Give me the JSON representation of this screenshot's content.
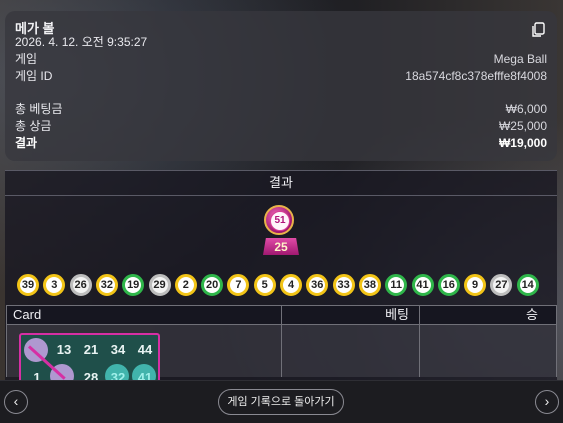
{
  "summary": {
    "title": "메가 볼",
    "datetime": "2026. 4. 12. 오전 9:35:27",
    "rows": [
      {
        "label": "게임",
        "value": "Mega Ball"
      },
      {
        "label": "게임 ID",
        "value": "18a574cf8c378efffe8f4008"
      }
    ],
    "totals": [
      {
        "label": "총 베팅금",
        "value": "₩6,000"
      },
      {
        "label": "총 상금",
        "value": "₩25,000"
      },
      {
        "label": "결과",
        "value": "₩19,000"
      }
    ]
  },
  "results": {
    "heading": "결과",
    "megaball": "51",
    "multiplier": "25",
    "balls": [
      {
        "n": "39",
        "c": "y"
      },
      {
        "n": "3",
        "c": "y"
      },
      {
        "n": "26",
        "c": "w"
      },
      {
        "n": "32",
        "c": "y"
      },
      {
        "n": "19",
        "c": "g"
      },
      {
        "n": "29",
        "c": "w"
      },
      {
        "n": "2",
        "c": "y"
      },
      {
        "n": "20",
        "c": "g"
      },
      {
        "n": "7",
        "c": "y"
      },
      {
        "n": "5",
        "c": "y"
      },
      {
        "n": "4",
        "c": "y"
      },
      {
        "n": "36",
        "c": "y"
      },
      {
        "n": "33",
        "c": "y"
      },
      {
        "n": "38",
        "c": "y"
      },
      {
        "n": "11",
        "c": "g"
      },
      {
        "n": "41",
        "c": "g"
      },
      {
        "n": "16",
        "c": "g"
      },
      {
        "n": "9",
        "c": "y"
      },
      {
        "n": "27",
        "c": "w"
      },
      {
        "n": "14",
        "c": "g"
      }
    ]
  },
  "table": {
    "headers": [
      "Card",
      "베팅",
      "승"
    ],
    "card_numbers": [
      "13",
      "21",
      "34",
      "44",
      "1",
      "28",
      "32",
      "41"
    ]
  },
  "footer": {
    "back_label": "게임 기록으로 돌아가기",
    "prev_icon": "‹",
    "next_icon": "›"
  }
}
